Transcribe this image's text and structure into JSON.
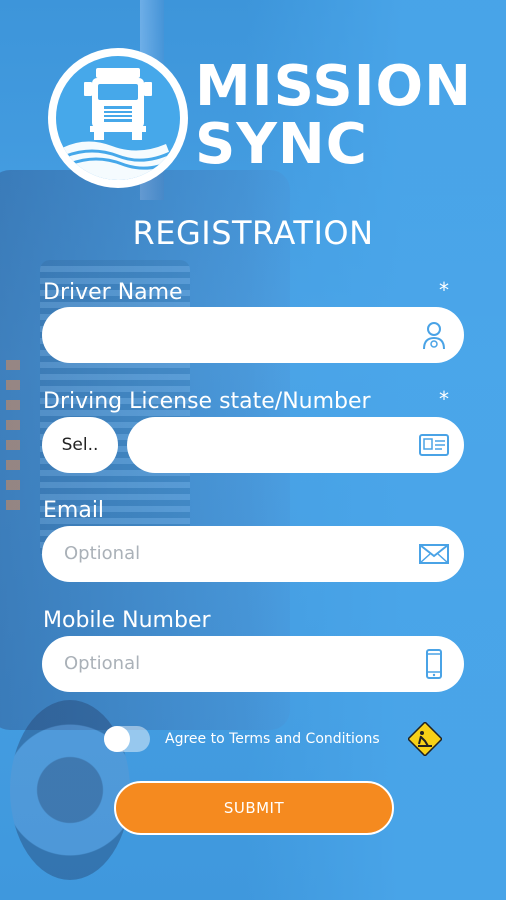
{
  "app": {
    "brand_line1": "MISSION",
    "brand_line2": "SYNC",
    "page_title": "REGISTRATION"
  },
  "form": {
    "driver_name": {
      "label": "Driver Name",
      "required": "*",
      "value": "",
      "icon": "driver-person-icon"
    },
    "license": {
      "label": "Driving License state/Number",
      "required": "*",
      "state_select": "Sel..",
      "value": "",
      "icon": "id-card-icon"
    },
    "email": {
      "label": "Email",
      "placeholder": "Optional",
      "icon": "envelope-icon"
    },
    "mobile": {
      "label": "Mobile Number",
      "placeholder": "Optional",
      "icon": "mobile-phone-icon"
    }
  },
  "terms": {
    "label": "Agree to Terms and Conditions",
    "toggle_on": false,
    "icon": "road-work-warning-icon"
  },
  "submit": {
    "label": "SUBMIT"
  },
  "colors": {
    "accent": "#f58a1f",
    "background": "#46a8ea",
    "field": "#ffffff"
  }
}
